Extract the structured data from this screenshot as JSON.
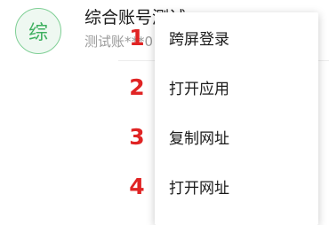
{
  "account": {
    "avatar_char": "综",
    "name": "综合账号测试",
    "subtitle": "测试账***0"
  },
  "menu": {
    "items": [
      {
        "label": "跨屏登录",
        "step": "1"
      },
      {
        "label": "打开应用",
        "step": "2"
      },
      {
        "label": "复制网址",
        "step": "3"
      },
      {
        "label": "打开网址",
        "step": "4"
      }
    ]
  },
  "colors": {
    "step_number": "#e02424",
    "avatar": "#3fb060"
  }
}
